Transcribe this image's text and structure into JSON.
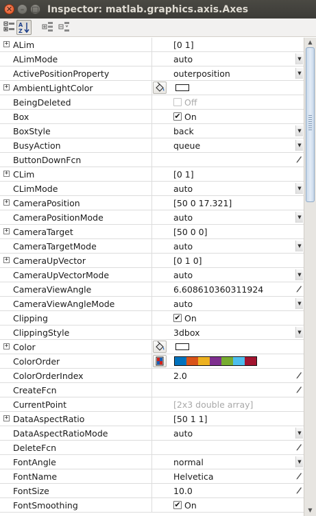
{
  "window": {
    "title": "Inspector:  matlab.graphics.axis.Axes",
    "close_glyph": "✕",
    "min_glyph": "–",
    "max_glyph": "□"
  },
  "toolbar": {
    "buttons": [
      "categorized-view-icon",
      "alphabetical-sort-icon",
      "expand-all-icon",
      "collapse-all-icon"
    ]
  },
  "properties": [
    {
      "name": "ALim",
      "expandable": true,
      "value": "[0 1]",
      "editor": "none"
    },
    {
      "name": "ALimMode",
      "expandable": false,
      "value": "auto",
      "editor": "dropdown"
    },
    {
      "name": "ActivePositionProperty",
      "expandable": false,
      "value": "outerposition",
      "editor": "dropdown"
    },
    {
      "name": "AmbientLightColor",
      "expandable": true,
      "type": "color",
      "color": "#ffffff",
      "editor": "none"
    },
    {
      "name": "BeingDeleted",
      "expandable": false,
      "type": "checkbox",
      "checked": false,
      "disabled": true,
      "value": "Off",
      "editor": "none"
    },
    {
      "name": "Box",
      "expandable": false,
      "type": "checkbox",
      "checked": true,
      "value": "On",
      "editor": "none"
    },
    {
      "name": "BoxStyle",
      "expandable": false,
      "value": "back",
      "editor": "dropdown"
    },
    {
      "name": "BusyAction",
      "expandable": false,
      "value": "queue",
      "editor": "dropdown"
    },
    {
      "name": "ButtonDownFcn",
      "expandable": false,
      "value": "",
      "editor": "pencil"
    },
    {
      "name": "CLim",
      "expandable": true,
      "value": "[0 1]",
      "editor": "none"
    },
    {
      "name": "CLimMode",
      "expandable": false,
      "value": "auto",
      "editor": "dropdown"
    },
    {
      "name": "CameraPosition",
      "expandable": true,
      "value": "[50 0 17.321]",
      "editor": "none"
    },
    {
      "name": "CameraPositionMode",
      "expandable": false,
      "value": "auto",
      "editor": "dropdown"
    },
    {
      "name": "CameraTarget",
      "expandable": true,
      "value": "[50 0 0]",
      "editor": "none"
    },
    {
      "name": "CameraTargetMode",
      "expandable": false,
      "value": "auto",
      "editor": "dropdown"
    },
    {
      "name": "CameraUpVector",
      "expandable": true,
      "value": "[0 1 0]",
      "editor": "none"
    },
    {
      "name": "CameraUpVectorMode",
      "expandable": false,
      "value": "auto",
      "editor": "dropdown"
    },
    {
      "name": "CameraViewAngle",
      "expandable": false,
      "value": "6.608610360311924",
      "editor": "pencil"
    },
    {
      "name": "CameraViewAngleMode",
      "expandable": false,
      "value": "auto",
      "editor": "dropdown"
    },
    {
      "name": "Clipping",
      "expandable": false,
      "type": "checkbox",
      "checked": true,
      "value": "On",
      "editor": "none"
    },
    {
      "name": "ClippingStyle",
      "expandable": false,
      "value": "3dbox",
      "editor": "dropdown"
    },
    {
      "name": "Color",
      "expandable": true,
      "type": "color",
      "color": "#ffffff",
      "editor": "none"
    },
    {
      "name": "ColorOrder",
      "expandable": false,
      "type": "colororder",
      "colors": [
        "#0072bd",
        "#d95319",
        "#edb120",
        "#7e2f8e",
        "#77ac30",
        "#4dbeee",
        "#a2142f"
      ],
      "editor": "none"
    },
    {
      "name": "ColorOrderIndex",
      "expandable": false,
      "value": "2.0",
      "editor": "pencil"
    },
    {
      "name": "CreateFcn",
      "expandable": false,
      "value": "",
      "editor": "pencil"
    },
    {
      "name": "CurrentPoint",
      "expandable": false,
      "value": "[2x3  double array]",
      "gray": true,
      "editor": "none"
    },
    {
      "name": "DataAspectRatio",
      "expandable": true,
      "value": "[50 1 1]",
      "editor": "none"
    },
    {
      "name": "DataAspectRatioMode",
      "expandable": false,
      "value": "auto",
      "editor": "dropdown"
    },
    {
      "name": "DeleteFcn",
      "expandable": false,
      "value": "",
      "editor": "pencil"
    },
    {
      "name": "FontAngle",
      "expandable": false,
      "value": "normal",
      "editor": "dropdown"
    },
    {
      "name": "FontName",
      "expandable": false,
      "value": "Helvetica",
      "editor": "pencil"
    },
    {
      "name": "FontSize",
      "expandable": false,
      "value": "10.0",
      "editor": "pencil"
    },
    {
      "name": "FontSmoothing",
      "expandable": false,
      "type": "checkbox",
      "checked": true,
      "value": "On",
      "editor": "none"
    }
  ]
}
